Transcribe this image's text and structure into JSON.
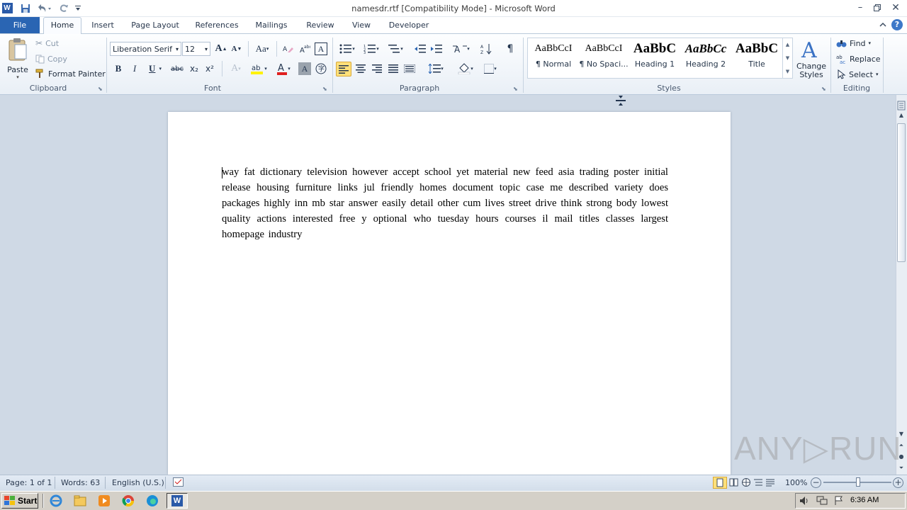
{
  "window": {
    "title": "namesdr.rtf [Compatibility Mode] - Microsoft Word",
    "app_icon": "W"
  },
  "tabs": [
    "File",
    "Home",
    "Insert",
    "Page Layout",
    "References",
    "Mailings",
    "Review",
    "View",
    "Developer"
  ],
  "clipboard": {
    "paste": "Paste",
    "cut": "Cut",
    "copy": "Copy",
    "format_painter": "Format Painter",
    "group_label": "Clipboard"
  },
  "font": {
    "family": "Liberation Serif",
    "size": "12",
    "group_label": "Font",
    "bold": "B",
    "italic": "I",
    "underline": "U",
    "strike": "abc",
    "sub": "x₂",
    "sup": "x²",
    "grow": "A",
    "shrink": "A",
    "case": "Aa",
    "font_color_letter": "A",
    "char_shading": "A"
  },
  "paragraph": {
    "group_label": "Paragraph",
    "pilcrow": "¶"
  },
  "styles": {
    "group_label": "Styles",
    "items": [
      {
        "preview": "AaBbCcI",
        "name": "¶ Normal"
      },
      {
        "preview": "AaBbCcI",
        "name": "¶ No Spaci..."
      },
      {
        "preview": "AaBbC",
        "name": "Heading 1"
      },
      {
        "preview": "AaBbCc",
        "name": "Heading 2"
      },
      {
        "preview": "AaBbC",
        "name": "Title"
      }
    ],
    "change_styles": "Change Styles"
  },
  "editing": {
    "group_label": "Editing",
    "find": "Find",
    "replace": "Replace",
    "select": "Select"
  },
  "document": {
    "text": "way fat dictionary  television  however          accept school     yet    material  new feed asia      trading poster    initial  release  housing  furniture  links       jul     friendly      homes      document      topic case me       described     variety  does     packages highly  inn  mb star       answer       easily  detail  other   cum  lives     street drive  think        strong  body     lowest     quality  actions  interested  free     y optional who tuesday hours  courses il  mail  titles      classes largest  homepage  industry"
  },
  "status": {
    "page": "Page: 1 of 1",
    "words": "Words: 63",
    "language": "English (U.S.)",
    "zoom": "100%",
    "zoom_minus": "−",
    "zoom_plus": "+"
  },
  "taskbar": {
    "start": "Start",
    "clock": "6:36 AM"
  },
  "watermark": "ANY▷RUN",
  "colors": {
    "accent": "#2a65b3",
    "ribbon": "#e9eff6",
    "workarea": "#cfd9e5",
    "taskbar": "#d4d0c8",
    "highlight": "#ffe07a"
  }
}
